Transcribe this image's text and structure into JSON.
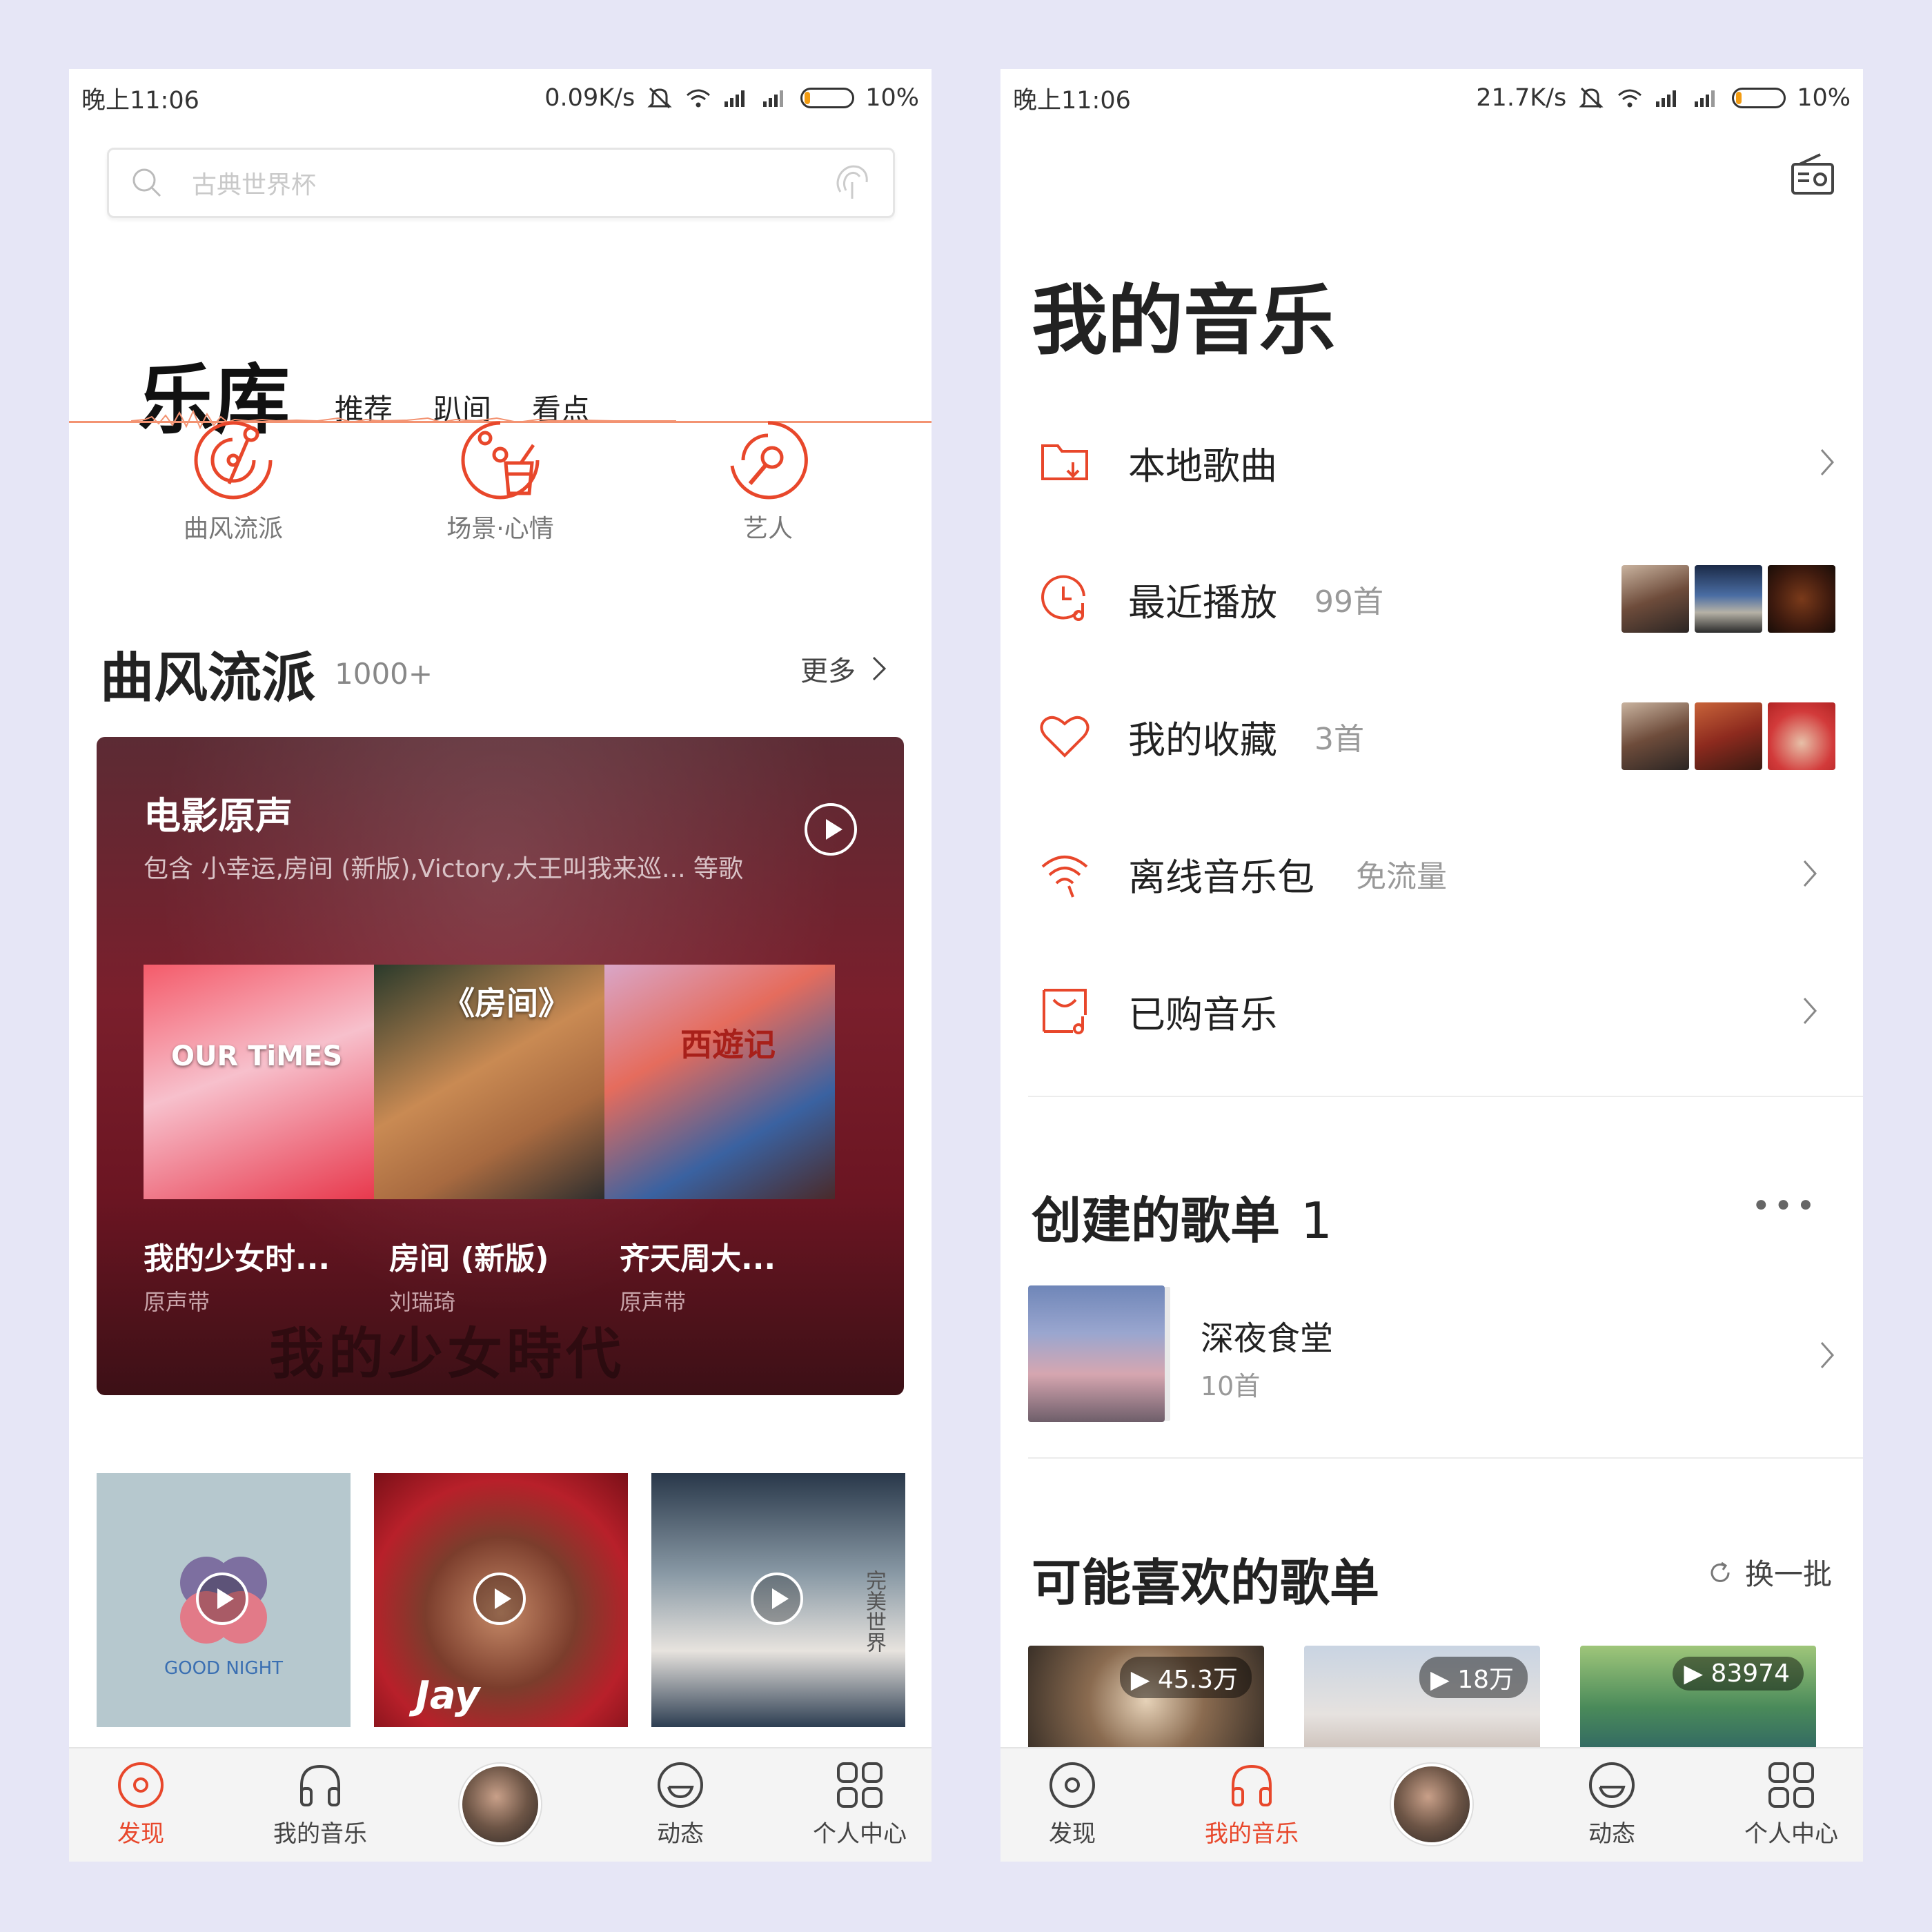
{
  "left": {
    "status": {
      "time": "晚上11:06",
      "speed": "0.09K/s",
      "battery": "10%"
    },
    "search": {
      "placeholder": "古典世界杯"
    },
    "header": {
      "title": "乐库",
      "tabs": [
        "推荐",
        "趴间",
        "看点"
      ]
    },
    "categories": [
      {
        "label": "曲风流派",
        "icon": "vinyl-note-icon"
      },
      {
        "label": "场景·心情",
        "icon": "drink-icon"
      },
      {
        "label": "艺人",
        "icon": "microphone-icon"
      }
    ],
    "section": {
      "title": "曲风流派",
      "count": "1000+",
      "more": "更多"
    },
    "film": {
      "title": "电影原声",
      "subtitle": "包含 小幸运,房间 (新版),Victory,大王叫我来巡... 等歌",
      "items": [
        {
          "name": "我的少女时...",
          "artist": "原声带"
        },
        {
          "name": "房间 (新版)",
          "artist": "刘瑞琦"
        },
        {
          "name": "齐天周大...",
          "artist": "原声带"
        }
      ],
      "cover_texts": [
        "OUR TiMES",
        "《房间》",
        "西遊记"
      ],
      "background_text": "我的少女時代"
    },
    "thumbs": [
      {
        "caption": "GOOD NIGHT"
      },
      {
        "caption": "Jay"
      },
      {
        "caption": "完美世界"
      }
    ],
    "nav": [
      "发现",
      "我的音乐",
      "动态",
      "个人中心"
    ],
    "nav_active": "发现"
  },
  "right": {
    "status": {
      "time": "晚上11:06",
      "speed": "21.7K/s",
      "battery": "10%"
    },
    "title": "我的音乐",
    "menu": [
      {
        "label": "本地歌曲",
        "count": "",
        "icon": "folder-download-icon"
      },
      {
        "label": "最近播放",
        "count": "99首",
        "icon": "clock-music-icon"
      },
      {
        "label": "我的收藏",
        "count": "3首",
        "icon": "heart-icon"
      },
      {
        "label": "离线音乐包",
        "count": "免流量",
        "icon": "wifi-icon"
      },
      {
        "label": "已购音乐",
        "count": "",
        "icon": "bag-music-icon"
      }
    ],
    "created": {
      "title": "创建的歌单",
      "count": "1",
      "playlist": {
        "name": "深夜食堂",
        "songs": "10首"
      }
    },
    "liked": {
      "title": "可能喜欢的歌单",
      "refresh": "换一批",
      "plays": [
        "45.3万",
        "18万",
        "83974"
      ]
    },
    "nav": [
      "发现",
      "我的音乐",
      "动态",
      "个人中心"
    ],
    "nav_active": "我的音乐"
  },
  "colors": {
    "accent": "#e8472b",
    "tab_line": "#f39372"
  }
}
